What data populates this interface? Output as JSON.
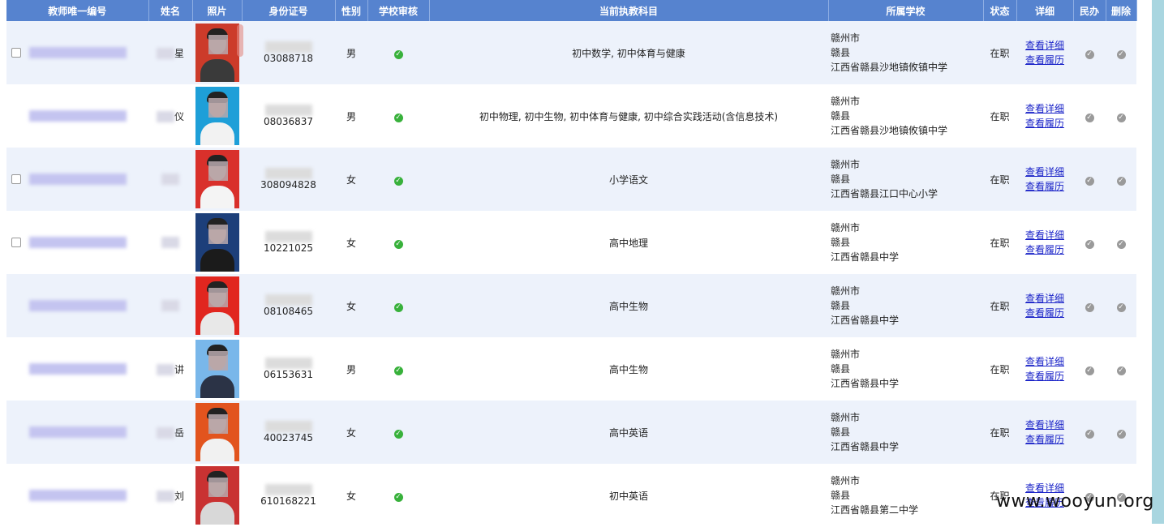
{
  "headers": [
    "教师唯一编号",
    "姓名",
    "照片",
    "身份证号",
    "性别",
    "学校审核",
    "当前执教科目",
    "所属学校",
    "状态",
    "详细",
    "民办",
    "删除"
  ],
  "rows": [
    {
      "name_suffix": "星",
      "id_tail": "03088718",
      "gender": "男",
      "subject": "初中数学, 初中体育与健康",
      "city": "赣州市",
      "county": "赣县",
      "school": "江西省赣县沙地镇攸镇中学",
      "status": "在职",
      "bg": "#cc3b2a",
      "shirt": "#3a3a3a",
      "checkbox": true
    },
    {
      "name_suffix": "仪",
      "id_tail": "08036837",
      "gender": "男",
      "subject": "初中物理, 初中生物, 初中体育与健康, 初中综合实践活动(含信息技术)",
      "city": "赣州市",
      "county": "赣县",
      "school": "江西省赣县沙地镇攸镇中学",
      "status": "在职",
      "bg": "#1e9fd8",
      "shirt": "#f2f2f2",
      "checkbox": false
    },
    {
      "name_suffix": "",
      "id_tail": "308094828",
      "gender": "女",
      "subject": "小学语文",
      "city": "赣州市",
      "county": "赣县",
      "school": "江西省赣县江口中心小学",
      "status": "在职",
      "bg": "#d9302b",
      "shirt": "#f4f4f4",
      "checkbox": true
    },
    {
      "name_suffix": "",
      "id_tail": "10221025",
      "gender": "女",
      "subject": "高中地理",
      "city": "赣州市",
      "county": "赣县",
      "school": "江西省赣县中学",
      "status": "在职",
      "bg": "#1d3f7a",
      "shirt": "#1b1b1b",
      "checkbox": true
    },
    {
      "name_suffix": "",
      "id_tail": "08108465",
      "gender": "女",
      "subject": "高中生物",
      "city": "赣州市",
      "county": "赣县",
      "school": "江西省赣县中学",
      "status": "在职",
      "bg": "#e1261f",
      "shirt": "#e8e8e8",
      "checkbox": false
    },
    {
      "name_suffix": "讲",
      "id_tail": "06153631",
      "gender": "男",
      "subject": "高中生物",
      "city": "赣州市",
      "county": "赣县",
      "school": "江西省赣县中学",
      "status": "在职",
      "bg": "#79b7ea",
      "shirt": "#2b3346",
      "checkbox": false
    },
    {
      "name_suffix": "岳",
      "id_tail": "40023745",
      "gender": "女",
      "subject": "高中英语",
      "city": "赣州市",
      "county": "赣县",
      "school": "江西省赣县中学",
      "status": "在职",
      "bg": "#e2541e",
      "shirt": "#f1f1f1",
      "checkbox": false
    },
    {
      "name_suffix": "刘",
      "id_tail": "610168221",
      "gender": "女",
      "subject": "初中英语",
      "city": "赣州市",
      "county": "赣县",
      "school": "江西省赣县第二中学",
      "status": "在职",
      "bg": "#c93232",
      "shirt": "#d8d8d8",
      "checkbox": false
    }
  ],
  "links": {
    "detail": "查看详细",
    "resume": "查看履历"
  },
  "watermark": "www.wooyun.org",
  "colors": {
    "header": "#5683cf",
    "odd_row": "#edf2fb",
    "link": "#1a23c8",
    "approved": "#38b13b"
  }
}
